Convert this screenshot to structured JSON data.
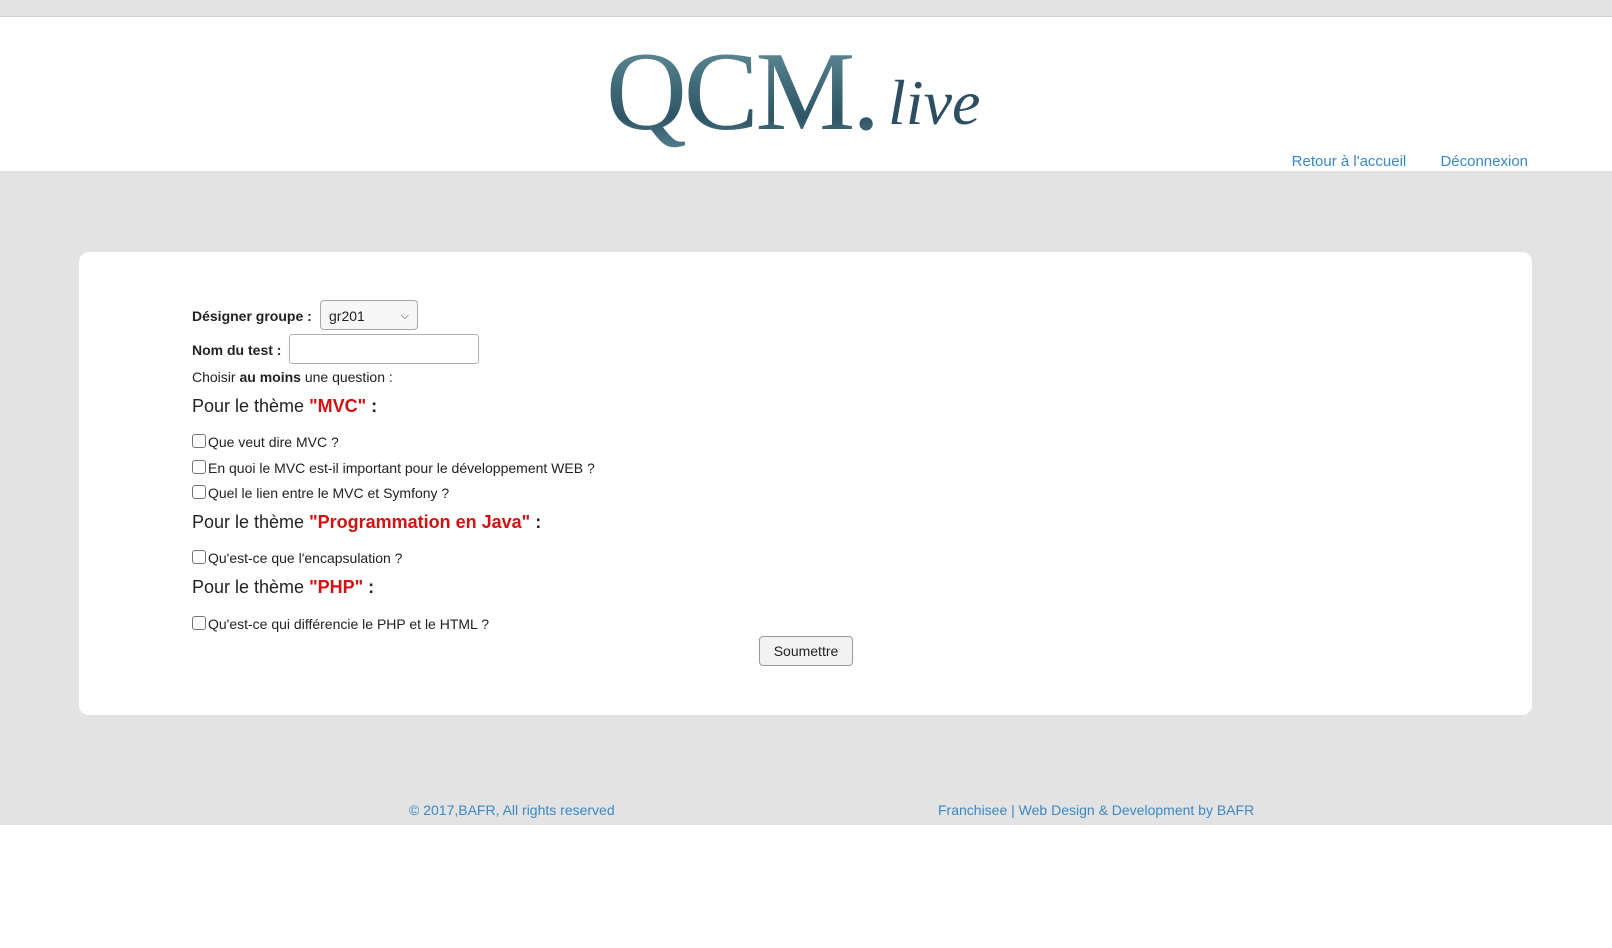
{
  "header": {
    "logo_main": "QCM.",
    "logo_sub": "live",
    "nav": [
      "Retour à l'accueil",
      "Déconnexion"
    ]
  },
  "form": {
    "group_label": "Désigner groupe :",
    "group_value": "gr201",
    "test_label": "Nom du test :",
    "test_value": "",
    "instruction_pre": "Choisir ",
    "instruction_bold": "au moins",
    "instruction_post": " une question :",
    "themes": [
      {
        "prefix": "Pour le thème ",
        "name": "\"MVC\"",
        "suffix": " :",
        "questions": [
          "Que veut dire MVC ?",
          "En quoi le MVC est-il important pour le développement WEB ?",
          "Quel le lien entre le MVC et Symfony ?"
        ]
      },
      {
        "prefix": "Pour le thème ",
        "name": "\"Programmation en Java\"",
        "suffix": " :",
        "questions": [
          "Qu'est-ce que l'encapsulation ?"
        ]
      },
      {
        "prefix": "Pour le thème ",
        "name": "\"PHP\"",
        "suffix": " :",
        "questions": [
          "Qu'est-ce qui différencie le PHP et le HTML ?"
        ]
      }
    ],
    "submit_label": "Soumettre"
  },
  "footer": {
    "copyright": "© 2017,BAFR, All rights reserved",
    "credits": "Franchisee | Web Design & Development by BAFR"
  },
  "colors": {
    "link": "#3a88c4",
    "theme_name": "#d41010",
    "background": "#e3e3e3"
  }
}
